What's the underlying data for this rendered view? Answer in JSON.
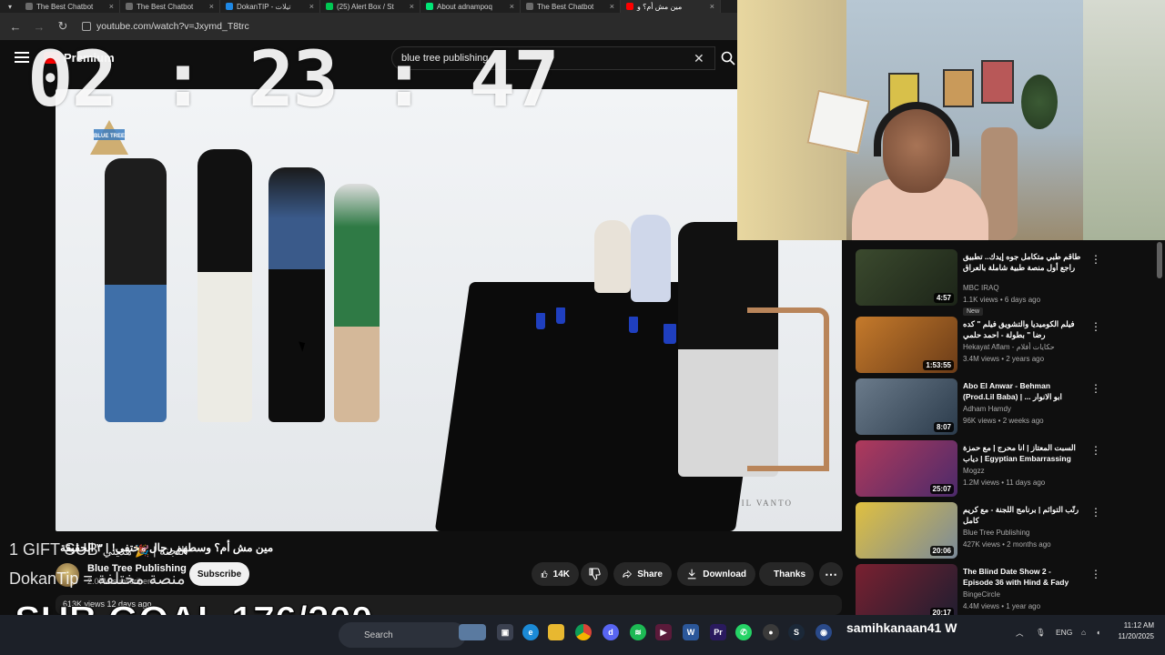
{
  "browser": {
    "tabs": [
      {
        "label": "The Best Chatbot",
        "color": "#6b6b6b"
      },
      {
        "label": "The Best Chatbot",
        "color": "#6b6b6b"
      },
      {
        "label": "DokanTIP - تيلات",
        "color": "#1e88e5"
      },
      {
        "label": "(25) Alert Box / St",
        "color": "#00c853"
      },
      {
        "label": "About adnampoq",
        "color": "#00e676"
      },
      {
        "label": "The Best Chatbot",
        "color": "#6b6b6b"
      },
      {
        "label": "مين مش أم؟ و",
        "color": "#ff0000"
      }
    ],
    "url": "youtube.com/watch?v=Jxymd_T8trc"
  },
  "youtube": {
    "logo": "Premium",
    "search_value": "blue tree publishing"
  },
  "video": {
    "watermark": "IL VANTO",
    "logo_text": "BLUE TREE"
  },
  "watch": {
    "title": "مين مش أم؟ وسطهم رجال مختفي! | ٣ الحقيقة",
    "channel": "Blue Tree Publishing",
    "subscribers": "2.07M subscribers",
    "subscribe_label": "Subscribe",
    "likes": "14K",
    "share_label": "Share",
    "download_label": "Download",
    "thanks_label": "Thanks",
    "views_line": "613K views  12 days ago"
  },
  "recommendations": [
    {
      "title": "طاقم طبي متكامل جوه إيدك.. تطبيق راجع أول منصة طبية شاملة بالعراق",
      "channel": "MBC IRAQ",
      "meta": "1.1K views • 6 days ago",
      "duration": "4:57",
      "badge": "New",
      "thumb_color": "#3b4a2e"
    },
    {
      "title": "فيلم الكوميديا والتشويق فيلم \" كده رضا \" بطولة - احمد حلمي",
      "channel": "Hekayat Aflam - حكايات أفلام",
      "meta": "3.4M views • 2 years ago",
      "duration": "1:53:55",
      "thumb_color": "#c57a2b"
    },
    {
      "title": "Abo El Anwar - Behman (Prod.Lil Baba) | ... ابو الانوار بهمان",
      "channel": "Adham Hamdy",
      "meta": "96K views • 2 weeks ago",
      "duration": "8:07",
      "thumb_color": "#4b5b6b"
    },
    {
      "title": "السبت المعتاز | انا محرج | مع حمزة دياب | Egyptian Embarrassing Videos",
      "channel": "Mogzz",
      "meta": "1.2M views • 11 days ago",
      "duration": "25:07",
      "thumb_color": "#b03a5b"
    },
    {
      "title": "رتّب التوائم | برنامج اللجنة - مع كريم كامل",
      "channel": "Blue Tree Publishing",
      "meta": "427K views • 2 months ago",
      "duration": "20:06",
      "thumb_color": "#e0c040"
    },
    {
      "title": "The Blind Date Show 2 - Episode 36 with Hind & Fady",
      "channel": "BingeCircle",
      "meta": "4.4M views • 1 year ago",
      "duration": "20:17",
      "thumb_color": "#7a2030"
    }
  ],
  "overlay": {
    "timer": "02 : 23 : 47",
    "gift": "1 GIFT SUB",
    "gift_arabic": "اللجنة | 🎉 هديتي",
    "dokan": "DokanTip",
    "dokan_arabic": "= منصة مختلفة",
    "sub_goal": "SUB GOAL 176/200"
  },
  "taskbar": {
    "search_placeholder": "Search",
    "username": "samihkanaan41",
    "username_suffix": "W",
    "lang": "ENG",
    "time": "11:12 AM",
    "date": "11/20/2025"
  }
}
